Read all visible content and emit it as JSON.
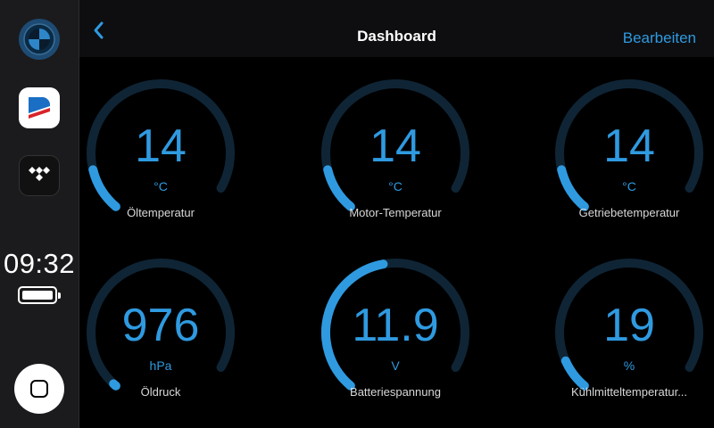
{
  "sidebar": {
    "apps": [
      {
        "name": "bmw-app"
      },
      {
        "name": "news-app"
      },
      {
        "name": "tidal-app"
      }
    ],
    "clock": "09:32"
  },
  "header": {
    "title": "Dashboard",
    "edit_label": "Bearbeiten"
  },
  "gauges": [
    {
      "value": "14",
      "unit": "°C",
      "label": "Öltemperatur",
      "fill": 0.14
    },
    {
      "value": "14",
      "unit": "°C",
      "label": "Motor-Temperatur",
      "fill": 0.14
    },
    {
      "value": "14",
      "unit": "°C",
      "label": "Getriebetemperatur",
      "fill": 0.14
    },
    {
      "value": "976",
      "unit": "hPa",
      "label": "Öldruck",
      "fill": 0.01
    },
    {
      "value": "11.9",
      "unit": "V",
      "label": "Batteriespannung",
      "fill": 0.5
    },
    {
      "value": "19",
      "unit": "%",
      "label": "Kühlmitteltemperatur...",
      "fill": 0.1
    }
  ],
  "colors": {
    "accent": "#2f9ae0",
    "track": "#0f2536",
    "background": "#000000",
    "sidebar": "#1b1b1d"
  }
}
